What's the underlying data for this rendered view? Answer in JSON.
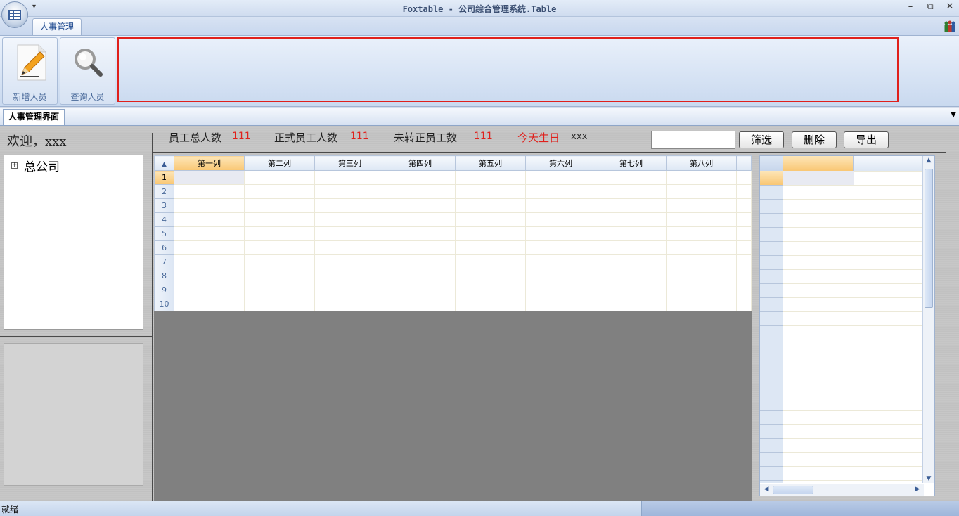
{
  "window": {
    "title": "Foxtable - 公司综合管理系统.Table",
    "qat_glyph": "▾"
  },
  "ribbon": {
    "tab": "人事管理",
    "buttons": [
      {
        "label": "新增人员",
        "icon": "pencil-document-icon"
      },
      {
        "label": "查询人员",
        "icon": "magnifier-icon"
      }
    ]
  },
  "doc_tab": "人事管理界面",
  "welcome": "欢迎，xxx",
  "tree": {
    "expander": "+",
    "root": "总公司"
  },
  "stats": {
    "total_label": "员工总人数",
    "total_value": "111",
    "formal_label": "正式员工人数",
    "formal_value": "111",
    "probation_label": "未转正员工数",
    "probation_value": "111",
    "birthday_label": "今天生日",
    "birthday_value": "xxx"
  },
  "filter_input": {
    "value": ""
  },
  "buttons": {
    "filter": "筛选",
    "delete": "删除",
    "export": "导出"
  },
  "grid": {
    "columns": [
      "第一列",
      "第二列",
      "第三列",
      "第四列",
      "第五列",
      "第六列",
      "第七列",
      "第八列"
    ],
    "rows": [
      "1",
      "2",
      "3",
      "4",
      "5",
      "6",
      "7",
      "8",
      "9",
      "10"
    ]
  },
  "status": {
    "text": "就绪"
  },
  "colors": {
    "accent_red": "#e0201b",
    "ribbon_blue": "#c9d9ef",
    "selection_orange": "#f9c774"
  }
}
